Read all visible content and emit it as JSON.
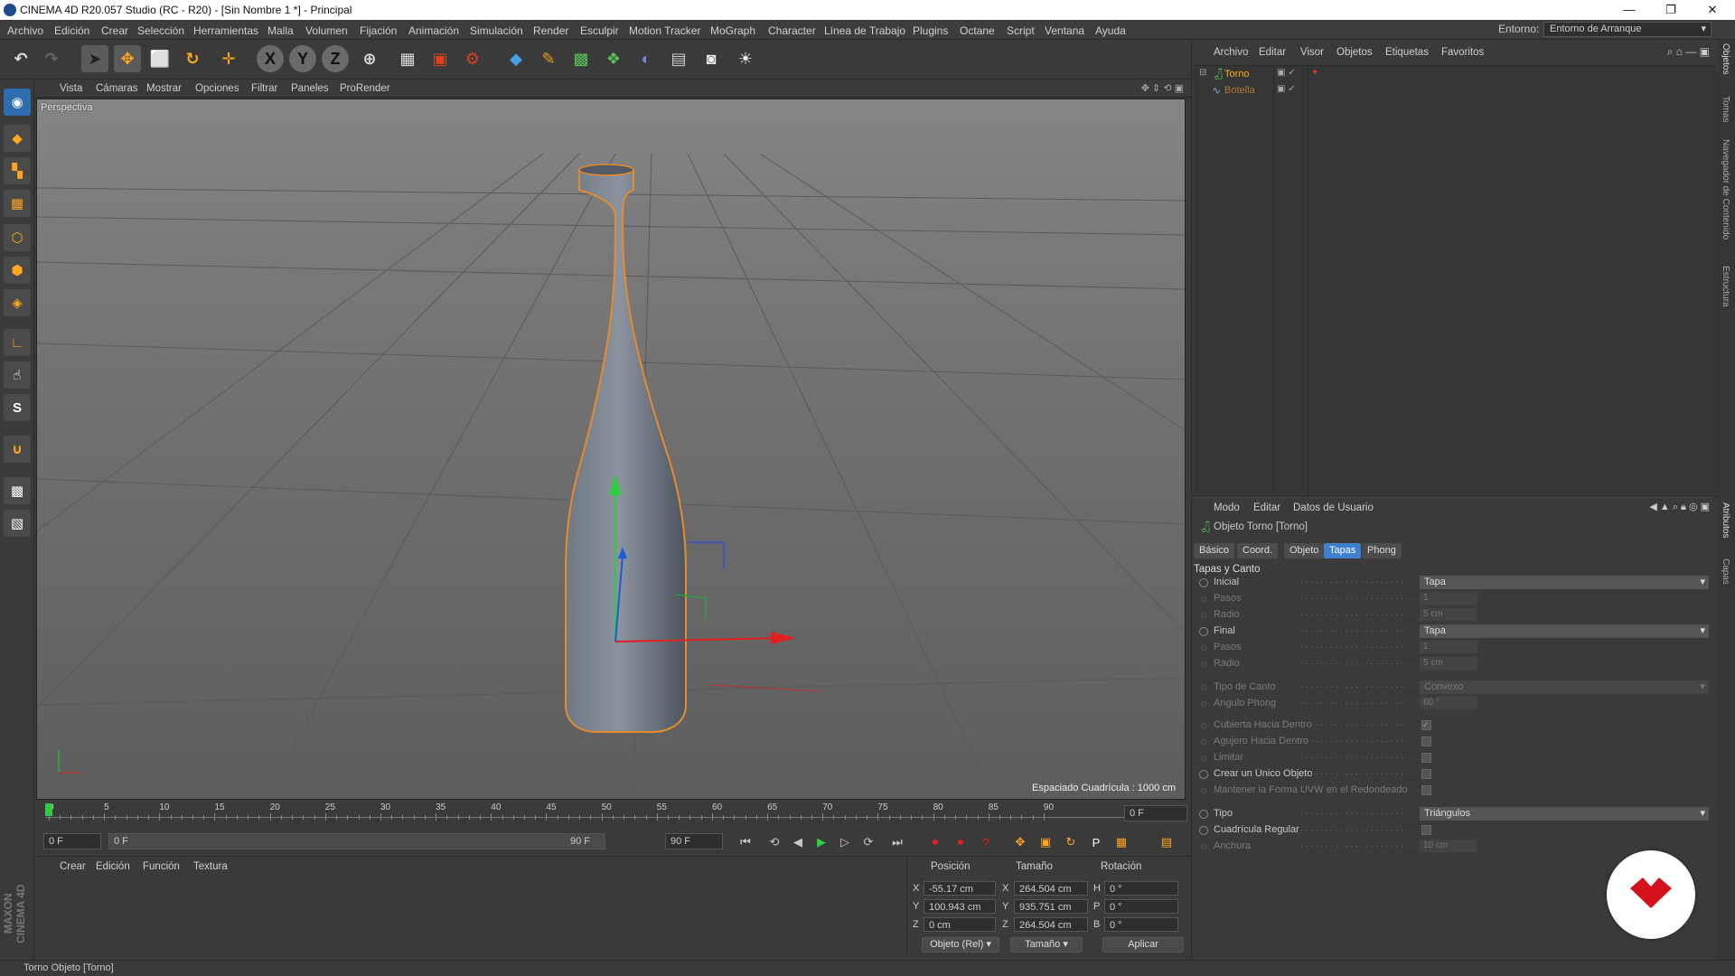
{
  "window": {
    "title": "CINEMA 4D R20.057 Studio (RC - R20) - [Sin Nombre 1 *] - Principal",
    "min": "—",
    "max": "❐",
    "close": "✕"
  },
  "menu": [
    "Archivo",
    "Edición",
    "Crear",
    "Selección",
    "Herramientas",
    "Malla",
    "Volumen",
    "Fijación",
    "Animación",
    "Simulación",
    "Render",
    "Esculpir",
    "Motion Tracker",
    "MoGraph",
    "Character",
    "Línea de Trabajo",
    "Plugins",
    "Octane",
    "Script",
    "Ventana",
    "Ayuda"
  ],
  "environment": {
    "label": "Entorno:",
    "value": "Entorno de Arranque"
  },
  "toolbar_icons": [
    "undo-icon",
    "redo-icon",
    "select-arrow-icon",
    "move-icon",
    "scale-icon",
    "rotate-icon",
    "transform-icon",
    "x-axis-icon",
    "y-axis-icon",
    "z-axis-icon",
    "world-coord-icon",
    "render-view-icon",
    "render-picture-icon",
    "render-settings-icon",
    "cube-icon",
    "pen-icon",
    "subdivision-icon",
    "cloner-icon",
    "deformer-icon",
    "floor-icon",
    "camera-icon",
    "light-icon"
  ],
  "viewport_menu": [
    "Vista",
    "Cámaras",
    "Mostrar",
    "Opciones",
    "Filtrar",
    "Paneles",
    "ProRender"
  ],
  "viewport": {
    "label": "Perspectiva",
    "grid_spacing": "Espaciado Cuadrícula : 1000 cm"
  },
  "timeline": {
    "ticks": [
      "0",
      "5",
      "10",
      "15",
      "20",
      "25",
      "30",
      "35",
      "40",
      "45",
      "50",
      "55",
      "60",
      "65",
      "70",
      "75",
      "80",
      "85",
      "90"
    ],
    "end_field": "0 F"
  },
  "transport": {
    "start": "0 F",
    "slider_left": "0 F",
    "slider_right": "90 F",
    "end": "90 F"
  },
  "material_menu": [
    "Crear",
    "Edición",
    "Función",
    "Textura"
  ],
  "coords": {
    "headers": [
      "Posición",
      "Tamaño",
      "Rotación"
    ],
    "rows": [
      {
        "axis": "X",
        "pos": "-55.17 cm",
        "size": "264.504 cm",
        "rlabel": "H",
        "rot": "0 °"
      },
      {
        "axis": "Y",
        "pos": "100.943 cm",
        "size": "935.751 cm",
        "rlabel": "P",
        "rot": "0 °"
      },
      {
        "axis": "Z",
        "pos": "0 cm",
        "size": "264.504 cm",
        "rlabel": "B",
        "rot": "0 °"
      }
    ],
    "mode": "Objeto (Rel)",
    "size_mode": "Tamaño",
    "apply": "Aplicar"
  },
  "object_menu": [
    "Archivo",
    "Editar",
    "Visor",
    "Objetos",
    "Etiquetas",
    "Favoritos"
  ],
  "objects": [
    {
      "name": "Torno"
    },
    {
      "name": "Botella"
    }
  ],
  "attr_menu": [
    "Modo",
    "Editar",
    "Datos de Usuario"
  ],
  "attr": {
    "object_title": "Objeto Torno [Torno]",
    "tabs": [
      "Básico",
      "Coord.",
      "Objeto",
      "Tapas",
      "Phong"
    ],
    "active_tab": "Tapas",
    "section": "Tapas y Canto",
    "rows": [
      {
        "label": "Inicial",
        "type": "dd",
        "value": "Tapa",
        "active": true
      },
      {
        "label": "Pasos",
        "type": "num",
        "value": "1",
        "active": false
      },
      {
        "label": "Radio",
        "type": "num",
        "value": "5 cm",
        "active": false
      },
      {
        "label": "Final",
        "type": "dd",
        "value": "Tapa",
        "active": true
      },
      {
        "label": "Pasos",
        "type": "num",
        "value": "1",
        "active": false
      },
      {
        "label": "Radio",
        "type": "num",
        "value": "5 cm",
        "active": false
      },
      {
        "label": "Tipo de Canto",
        "type": "dd",
        "value": "Convexo",
        "active": false
      },
      {
        "label": "Ángulo Phong",
        "type": "num",
        "value": "60 °",
        "active": false
      },
      {
        "label": "Cubierta Hacia Dentro",
        "type": "cb",
        "value": "✓",
        "active": false
      },
      {
        "label": "Agujero Hacia Dentro",
        "type": "cb",
        "value": "",
        "active": false
      },
      {
        "label": "Limitar",
        "type": "cb",
        "value": "",
        "active": false
      },
      {
        "label": "Crear un Único Objeto",
        "type": "cb",
        "value": "",
        "active": true
      },
      {
        "label": "Mantener la Forma UVW en el Redondeado",
        "type": "cb",
        "value": "",
        "active": false
      },
      {
        "label": "Tipo",
        "type": "dd",
        "value": "Triángulos",
        "active": true
      },
      {
        "label": "Cuadrícula Regular",
        "type": "cb",
        "value": "",
        "active": true
      },
      {
        "label": "Anchura",
        "type": "num",
        "value": "10 cm",
        "active": false
      }
    ]
  },
  "side_tabs": [
    "Objetos",
    "Tomas",
    "Navegador de Contenido",
    "Estructura",
    "Atributos",
    "Capas"
  ],
  "maxon": "MAXON CINEMA 4D",
  "status": "Torno Objeto [Torno]",
  "colors": {
    "accent": "#3f7fd0",
    "highlight": "#ffa520",
    "object_green": "#58c05a",
    "badge_red": "#d4121b"
  }
}
